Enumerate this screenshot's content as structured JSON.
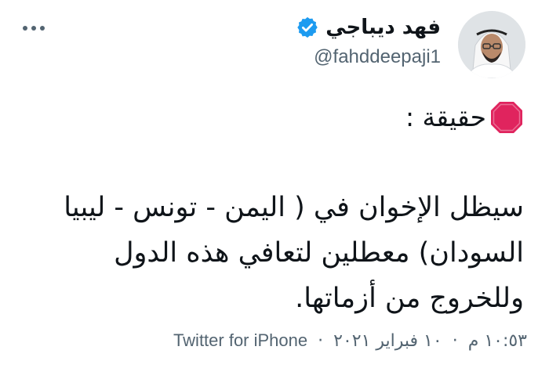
{
  "author": {
    "display_name": "فهد ديباجي",
    "handle": "@fahddeepaji1",
    "verified": true,
    "avatar_icon": "user-avatar"
  },
  "tweet": {
    "fact_label": "حقيقة :",
    "fact_icon": "stop-sign-icon",
    "lines": [
      "سيظل الإخوان في ( اليمن - تونس - ليبيا",
      "السودان) معطلين لتعافي هذه الدول",
      "وللخروج من أزماتها."
    ]
  },
  "meta": {
    "time": "١٠:٥٣ م",
    "date": "١٠ فبراير ٢٠٢١",
    "separator": "·",
    "source": "Twitter for iPhone"
  },
  "colors": {
    "text": "#0f1419",
    "secondary": "#536471",
    "verified": "#1d9bf0",
    "stop": "#e0245e"
  }
}
